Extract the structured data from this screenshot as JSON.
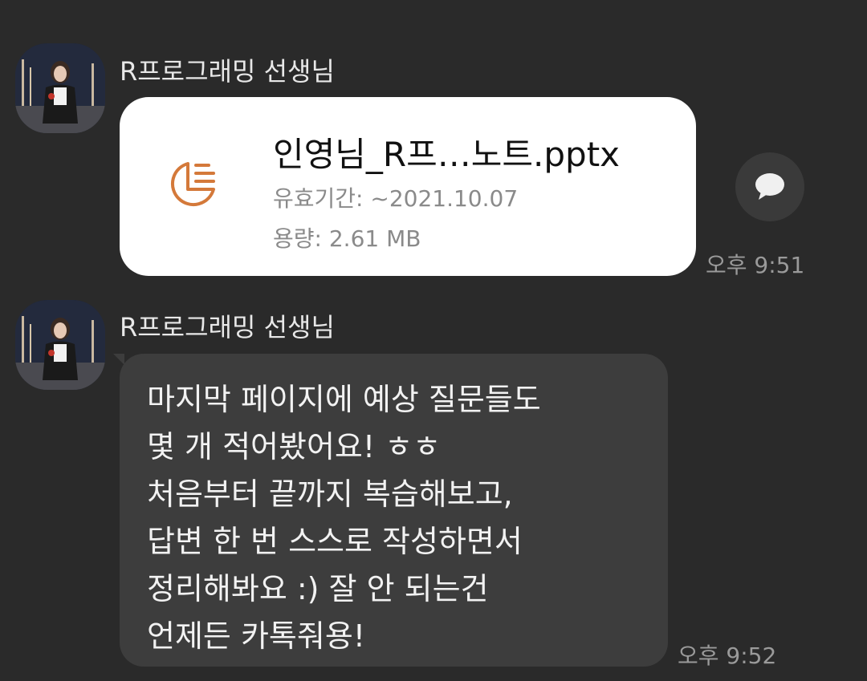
{
  "messages": [
    {
      "sender": "R프로그래밍 선생님",
      "type": "file",
      "file": {
        "icon": "ppt-file-icon",
        "name": "인영님_R프…노트.pptx",
        "expiry": "유효기간: ~2021.10.07",
        "size": "용량: 2.61 MB"
      },
      "time": "오후 9:51"
    },
    {
      "sender": "R프로그래밍 선생님",
      "type": "text",
      "lines": [
        "마지막 페이지에 예상 질문들도",
        "몇 개 적어봤어요! ㅎㅎ",
        "처음부터 끝까지 복습해보고,",
        "답변 한 번 스스로 작성하면서",
        "정리해봐요 :) 잘 안 되는건",
        "언제든 카톡줘용!"
      ],
      "time": "오후 9:52"
    }
  ],
  "colors": {
    "background": "#2a2a2a",
    "file_bubble": "#ffffff",
    "text_bubble": "#3d3d3d",
    "ppt_icon": "#d4793a"
  }
}
